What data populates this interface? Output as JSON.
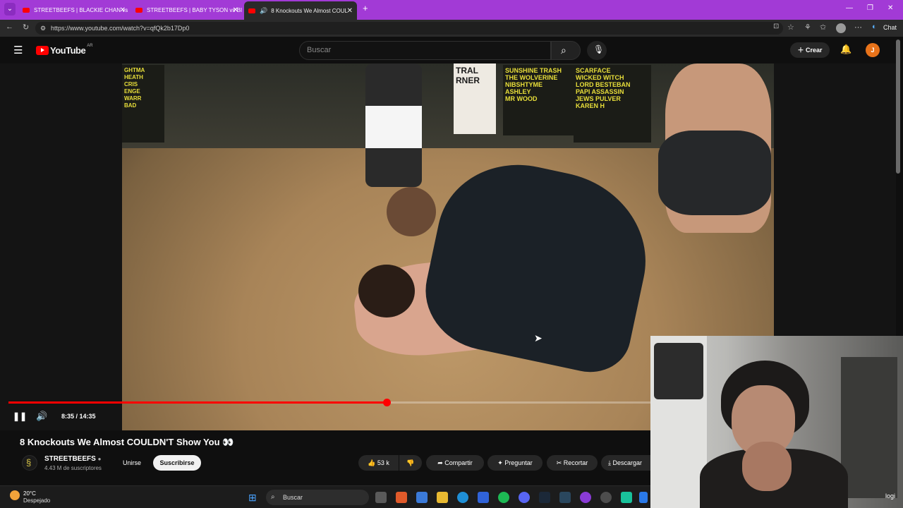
{
  "browser": {
    "tabs": [
      {
        "label": "STREETBEEFS | BLACKIE CHAN vs"
      },
      {
        "label": "STREETBEEFS | BABY TYSON vs BI"
      },
      {
        "label": "8 Knockouts We Almost COUL"
      }
    ],
    "url": "https://www.youtube.com/watch?v=qfQk2b17Dp0",
    "chat_label": "Chat"
  },
  "youtube": {
    "logo_text": "YouTube",
    "region": "AR",
    "search_placeholder": "Buscar",
    "create_label": "Crear",
    "avatar_letter": "J"
  },
  "video": {
    "banner_left": "GHTMA\nHEATH\nCRIS\nENGE\nWARR\nBAD",
    "corner_sign": "TRAL\nRNER",
    "names_a": "SUNSHINE TRASH\nTHE WOLVERINE\nNIBSHTYME\nASHLEY\nMR WOOD",
    "names_b": "SCARFACE\nWICKED WITCH\nLORD BESTEBAN\nPAPI ASSASSIN\nJEWS PULVER\nKAREN H",
    "time_display": "8:35 / 14:35",
    "progress_fraction": 0.5886
  },
  "details": {
    "title": "8 Knockouts We Almost COULDN'T Show You 👀",
    "channel_name": "STREETBEEFS",
    "subscribers": "4.43 M de suscriptores",
    "join_label": "Unirse",
    "subscribe_label": "Suscribirse",
    "likes": "53 k",
    "share_label": "Compartir",
    "ask_label": "Preguntar",
    "clip_label": "Recortar",
    "download_label": "Descargar"
  },
  "taskbar": {
    "temperature": "20°C",
    "condition": "Despejado",
    "search_label": "Buscar",
    "corner_text": "logi"
  },
  "colors": {
    "tab_strip": "#a23ad6",
    "youtube_red": "#ff0000",
    "avatar": "#e8731a"
  }
}
